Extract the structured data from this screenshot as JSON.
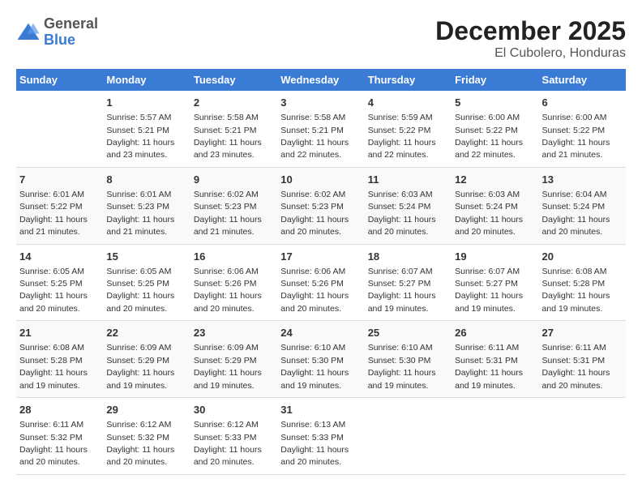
{
  "logo": {
    "general": "General",
    "blue": "Blue"
  },
  "title": "December 2025",
  "subtitle": "El Cubolero, Honduras",
  "headers": [
    "Sunday",
    "Monday",
    "Tuesday",
    "Wednesday",
    "Thursday",
    "Friday",
    "Saturday"
  ],
  "weeks": [
    [
      {
        "day": "",
        "info": ""
      },
      {
        "day": "1",
        "info": "Sunrise: 5:57 AM\nSunset: 5:21 PM\nDaylight: 11 hours\nand 23 minutes."
      },
      {
        "day": "2",
        "info": "Sunrise: 5:58 AM\nSunset: 5:21 PM\nDaylight: 11 hours\nand 23 minutes."
      },
      {
        "day": "3",
        "info": "Sunrise: 5:58 AM\nSunset: 5:21 PM\nDaylight: 11 hours\nand 22 minutes."
      },
      {
        "day": "4",
        "info": "Sunrise: 5:59 AM\nSunset: 5:22 PM\nDaylight: 11 hours\nand 22 minutes."
      },
      {
        "day": "5",
        "info": "Sunrise: 6:00 AM\nSunset: 5:22 PM\nDaylight: 11 hours\nand 22 minutes."
      },
      {
        "day": "6",
        "info": "Sunrise: 6:00 AM\nSunset: 5:22 PM\nDaylight: 11 hours\nand 21 minutes."
      }
    ],
    [
      {
        "day": "7",
        "info": "Sunrise: 6:01 AM\nSunset: 5:22 PM\nDaylight: 11 hours\nand 21 minutes."
      },
      {
        "day": "8",
        "info": "Sunrise: 6:01 AM\nSunset: 5:23 PM\nDaylight: 11 hours\nand 21 minutes."
      },
      {
        "day": "9",
        "info": "Sunrise: 6:02 AM\nSunset: 5:23 PM\nDaylight: 11 hours\nand 21 minutes."
      },
      {
        "day": "10",
        "info": "Sunrise: 6:02 AM\nSunset: 5:23 PM\nDaylight: 11 hours\nand 20 minutes."
      },
      {
        "day": "11",
        "info": "Sunrise: 6:03 AM\nSunset: 5:24 PM\nDaylight: 11 hours\nand 20 minutes."
      },
      {
        "day": "12",
        "info": "Sunrise: 6:03 AM\nSunset: 5:24 PM\nDaylight: 11 hours\nand 20 minutes."
      },
      {
        "day": "13",
        "info": "Sunrise: 6:04 AM\nSunset: 5:24 PM\nDaylight: 11 hours\nand 20 minutes."
      }
    ],
    [
      {
        "day": "14",
        "info": "Sunrise: 6:05 AM\nSunset: 5:25 PM\nDaylight: 11 hours\nand 20 minutes."
      },
      {
        "day": "15",
        "info": "Sunrise: 6:05 AM\nSunset: 5:25 PM\nDaylight: 11 hours\nand 20 minutes."
      },
      {
        "day": "16",
        "info": "Sunrise: 6:06 AM\nSunset: 5:26 PM\nDaylight: 11 hours\nand 20 minutes."
      },
      {
        "day": "17",
        "info": "Sunrise: 6:06 AM\nSunset: 5:26 PM\nDaylight: 11 hours\nand 20 minutes."
      },
      {
        "day": "18",
        "info": "Sunrise: 6:07 AM\nSunset: 5:27 PM\nDaylight: 11 hours\nand 19 minutes."
      },
      {
        "day": "19",
        "info": "Sunrise: 6:07 AM\nSunset: 5:27 PM\nDaylight: 11 hours\nand 19 minutes."
      },
      {
        "day": "20",
        "info": "Sunrise: 6:08 AM\nSunset: 5:28 PM\nDaylight: 11 hours\nand 19 minutes."
      }
    ],
    [
      {
        "day": "21",
        "info": "Sunrise: 6:08 AM\nSunset: 5:28 PM\nDaylight: 11 hours\nand 19 minutes."
      },
      {
        "day": "22",
        "info": "Sunrise: 6:09 AM\nSunset: 5:29 PM\nDaylight: 11 hours\nand 19 minutes."
      },
      {
        "day": "23",
        "info": "Sunrise: 6:09 AM\nSunset: 5:29 PM\nDaylight: 11 hours\nand 19 minutes."
      },
      {
        "day": "24",
        "info": "Sunrise: 6:10 AM\nSunset: 5:30 PM\nDaylight: 11 hours\nand 19 minutes."
      },
      {
        "day": "25",
        "info": "Sunrise: 6:10 AM\nSunset: 5:30 PM\nDaylight: 11 hours\nand 19 minutes."
      },
      {
        "day": "26",
        "info": "Sunrise: 6:11 AM\nSunset: 5:31 PM\nDaylight: 11 hours\nand 19 minutes."
      },
      {
        "day": "27",
        "info": "Sunrise: 6:11 AM\nSunset: 5:31 PM\nDaylight: 11 hours\nand 20 minutes."
      }
    ],
    [
      {
        "day": "28",
        "info": "Sunrise: 6:11 AM\nSunset: 5:32 PM\nDaylight: 11 hours\nand 20 minutes."
      },
      {
        "day": "29",
        "info": "Sunrise: 6:12 AM\nSunset: 5:32 PM\nDaylight: 11 hours\nand 20 minutes."
      },
      {
        "day": "30",
        "info": "Sunrise: 6:12 AM\nSunset: 5:33 PM\nDaylight: 11 hours\nand 20 minutes."
      },
      {
        "day": "31",
        "info": "Sunrise: 6:13 AM\nSunset: 5:33 PM\nDaylight: 11 hours\nand 20 minutes."
      },
      {
        "day": "",
        "info": ""
      },
      {
        "day": "",
        "info": ""
      },
      {
        "day": "",
        "info": ""
      }
    ]
  ]
}
